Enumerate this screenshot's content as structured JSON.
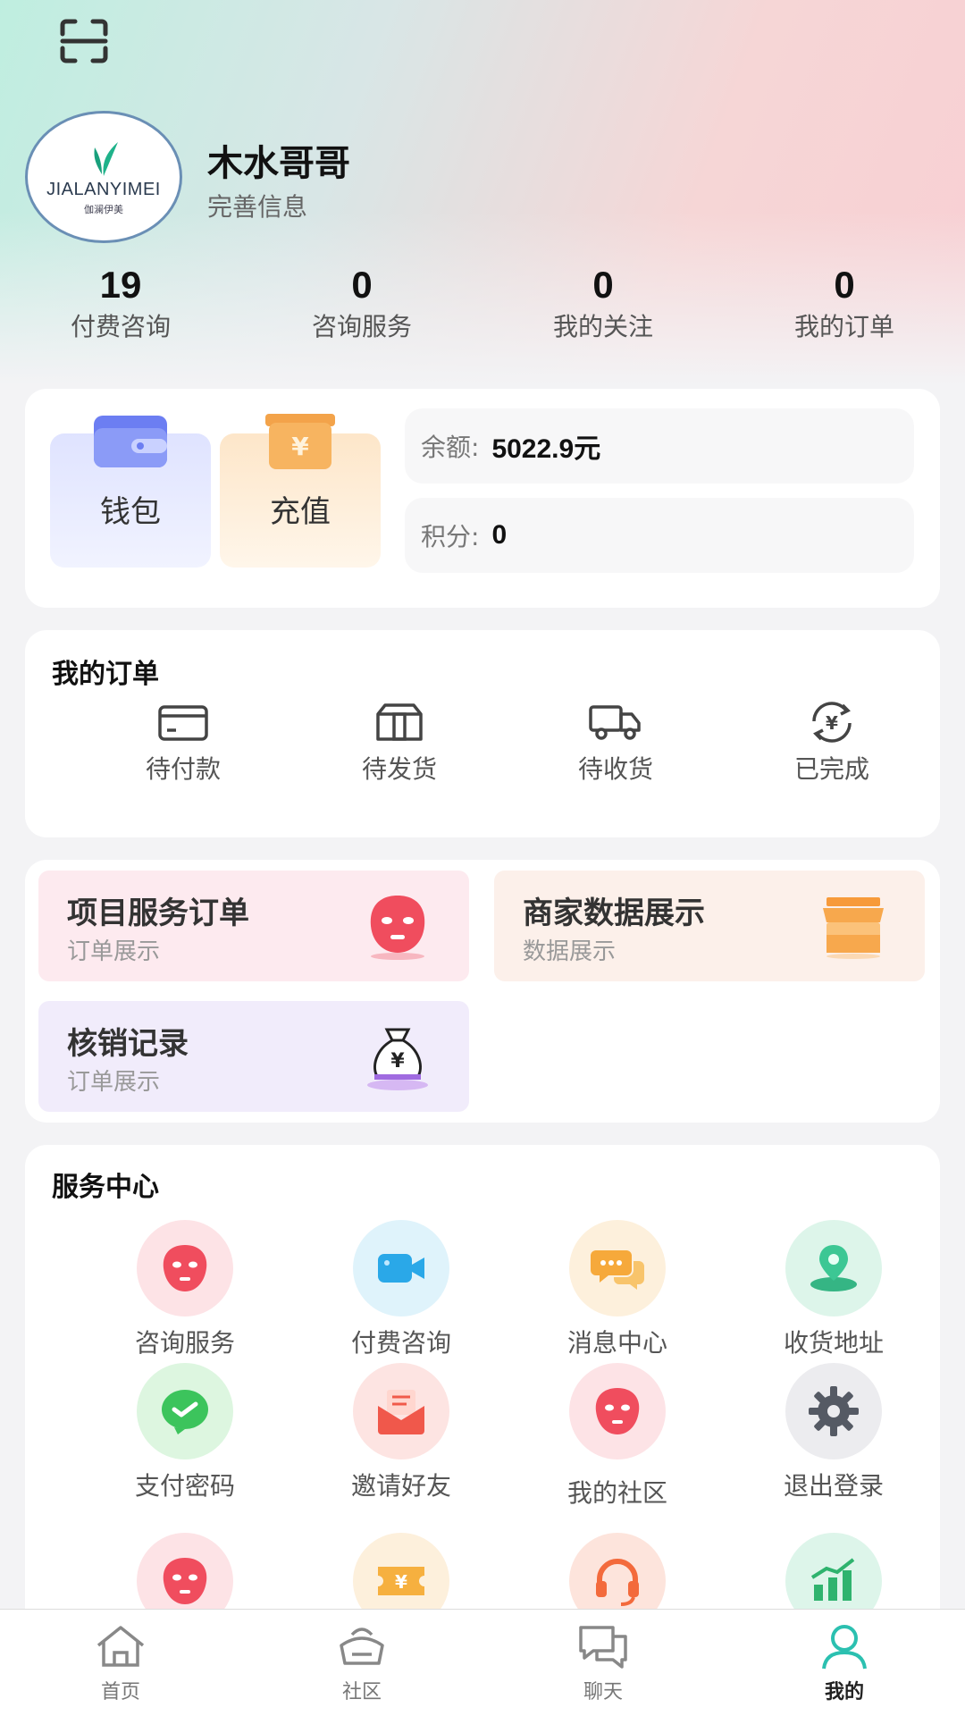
{
  "header": {
    "scan_icon": "scan-icon",
    "avatar": {
      "brand": "JIALANYIMEI",
      "brand_sub": "伽澜伊美"
    },
    "username": "木水哥哥",
    "complete_info": "完善信息"
  },
  "stats": [
    {
      "value": "19",
      "label": "付费咨询"
    },
    {
      "value": "0",
      "label": "咨询服务"
    },
    {
      "value": "0",
      "label": "我的关注"
    },
    {
      "value": "0",
      "label": "我的订单"
    }
  ],
  "wallet": {
    "wallet_label": "钱包",
    "recharge_label": "充值",
    "balance_key": "余额:",
    "balance_value": "5022.9元",
    "points_key": "积分:",
    "points_value": "0"
  },
  "orders": {
    "title": "我的订单",
    "items": [
      {
        "label": "待付款",
        "icon": "card-icon"
      },
      {
        "label": "待发货",
        "icon": "box-icon"
      },
      {
        "label": "待收货",
        "icon": "truck-icon"
      },
      {
        "label": "已完成",
        "icon": "yuan-refresh-icon"
      }
    ]
  },
  "features": [
    {
      "title": "项目服务订单",
      "subtitle": "订单展示",
      "icon": "face-mask-icon"
    },
    {
      "title": "商家数据展示",
      "subtitle": "数据展示",
      "icon": "shop-icon"
    },
    {
      "title": "核销记录",
      "subtitle": "订单展示",
      "icon": "money-bag-icon"
    }
  ],
  "services": {
    "title": "服务中心",
    "items": [
      {
        "label": "咨询服务",
        "icon": "face-mask-icon"
      },
      {
        "label": "付费咨询",
        "icon": "video-camera-icon"
      },
      {
        "label": "消息中心",
        "icon": "chat-bubbles-icon"
      },
      {
        "label": "收货地址",
        "icon": "location-icon"
      },
      {
        "label": "支付密码",
        "icon": "check-bubble-icon"
      },
      {
        "label": "邀请好友",
        "icon": "envelope-icon"
      },
      {
        "label": "我的社区",
        "icon": "face-mask-icon"
      },
      {
        "label": "退出登录",
        "icon": "gear-icon"
      },
      {
        "label": "",
        "icon": "face-mask-icon"
      },
      {
        "label": "",
        "icon": "ticket-icon"
      },
      {
        "label": "",
        "icon": "headset-icon"
      },
      {
        "label": "",
        "icon": "bar-chart-icon"
      }
    ]
  },
  "tabbar": [
    {
      "label": "首页",
      "icon": "home-icon"
    },
    {
      "label": "社区",
      "icon": "community-icon"
    },
    {
      "label": "聊天",
      "icon": "chat-icon"
    },
    {
      "label": "我的",
      "icon": "user-icon",
      "active": true
    }
  ],
  "colors": {
    "accent": "#2bc0b0",
    "mask_red": "#f04d5e",
    "balance_bg": "#f7f7f8"
  }
}
